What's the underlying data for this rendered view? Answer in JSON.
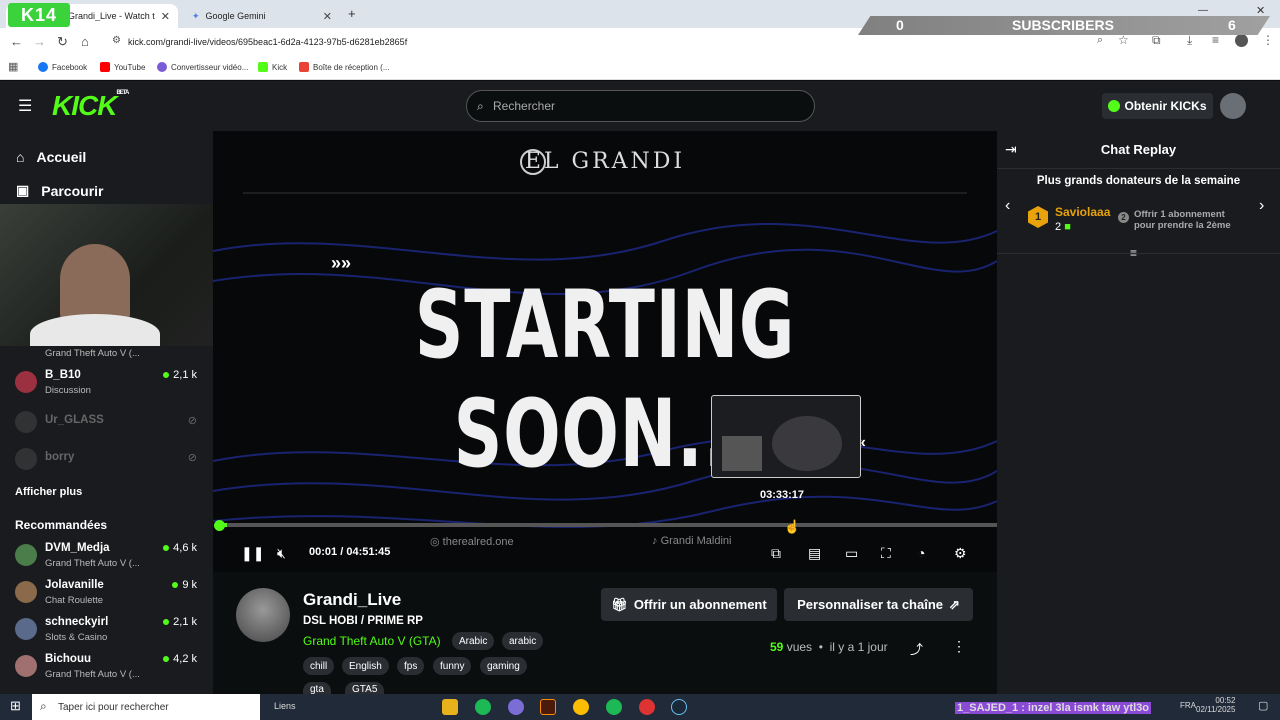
{
  "browser": {
    "tabs": [
      {
        "label": "Grandi_Live - Watch the VOD o",
        "active": true
      },
      {
        "label": "Google Gemini",
        "active": false
      }
    ],
    "url": "kick.com/grandi-live/videos/695beac1-6d2a-4123-97b5-d6281eb2865f",
    "bookmarks": [
      "Facebook",
      "YouTube",
      "Convertisseur vidéo...",
      "Kick",
      "Boîte de réception (..."
    ]
  },
  "overlay": {
    "badge": "K14",
    "subs_left": "0",
    "subs_label": "SUBSCRIBERS",
    "subs_right": "6"
  },
  "header": {
    "logo": "KICK",
    "logo_beta": "BETA",
    "search_placeholder": "Rechercher",
    "get_kicks": "Obtenir KICKs"
  },
  "sidebar": {
    "home": "Accueil",
    "browse": "Parcourir",
    "following": [
      {
        "name": "",
        "category": "Grand Theft Auto V (...",
        "viewers": ""
      },
      {
        "name": "B_B10",
        "category": "Discussion",
        "viewers": "2,1 k"
      },
      {
        "name": "Ur_GLASS",
        "offline": true
      },
      {
        "name": "borry",
        "offline": true
      }
    ],
    "show_more": "Afficher plus",
    "recommended_title": "Recommandées",
    "recommended": [
      {
        "name": "DVM_Medja",
        "category": "Grand Theft Auto V (...",
        "viewers": "4,6 k"
      },
      {
        "name": "Jolavanille",
        "category": "Chat Roulette",
        "viewers": "9 k"
      },
      {
        "name": "schneckyirl",
        "category": "Slots & Casino",
        "viewers": "2,1 k"
      },
      {
        "name": "Bichouu",
        "category": "Grand Theft Auto V (...",
        "viewers": "4,2 k"
      }
    ]
  },
  "video": {
    "brand": "EL GRANDI",
    "title": "STARTING SOON...",
    "preview_time": "03:33:17",
    "current_time": "00:01",
    "duration": "04:51:45",
    "time_sep": "/",
    "progress": 0.001,
    "watermark_1": "therealred.one",
    "watermark_2": "Grandi Maldini"
  },
  "chat": {
    "title": "Chat Replay",
    "donors_title": "Plus grands donateurs de la semaine",
    "top_donor": {
      "rank": "1",
      "name": "Saviolaaa",
      "count": "2"
    },
    "second_slot": "Offrir 1 abonnement pour prendre la 2ème",
    "second_rank": "2"
  },
  "channel": {
    "name": "Grandi_Live",
    "stream_title": "DSL HOBI / PRIME RP",
    "category": "Grand Theft Auto V (GTA)",
    "tags_row1": [
      "Arabic",
      "arabic"
    ],
    "tags_row2": [
      "chill",
      "English",
      "fps",
      "funny",
      "gaming"
    ],
    "tags_row3": [
      "gta",
      "GTA5"
    ],
    "gift_sub": "Offrir un abonnement",
    "customize": "Personnaliser ta chaîne",
    "views_count": "59",
    "views_label": "vues",
    "time_ago": "il y a 1 jour"
  },
  "taskbar": {
    "search_placeholder": "Taper ici pour rechercher",
    "links": "Liens",
    "ticker": "1_SAJED_1 : inzel 3la ismk taw ytl3o",
    "lang": "FRA",
    "time": "00:52",
    "date": "02/11/2025"
  }
}
